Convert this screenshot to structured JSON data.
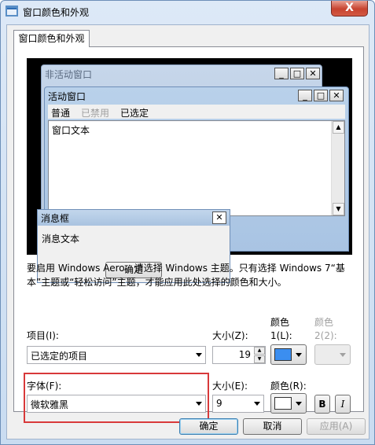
{
  "window": {
    "title": "窗口颜色和外观",
    "close_label": "X"
  },
  "tab": {
    "label": "窗口颜色和外观"
  },
  "preview": {
    "inactive_title": "非活动窗口",
    "active_title": "活动窗口",
    "menu": [
      "普通",
      "已禁用",
      "已选定"
    ],
    "window_text": "窗口文本",
    "msgbox_title": "消息框",
    "msgbox_text": "消息文本",
    "msgbox_ok": "确定"
  },
  "description": "要启用 Windows Aero，请选择 Windows 主题。只有选择 Windows 7“基本”主题或“轻松访问”主题，才能应用此处选择的颜色和大小。",
  "item": {
    "label": "项目(I):",
    "value": "已选定的项目",
    "size_label": "大小(Z):",
    "size_value": "19",
    "color1_label": "颜色\n1(L):",
    "color2_label": "颜色\n2(2):"
  },
  "font": {
    "label": "字体(F):",
    "value": "微软雅黑",
    "size_label": "大小(E):",
    "size_value": "9",
    "color_label": "颜色(R):",
    "bold": "B",
    "italic": "I"
  },
  "buttons": {
    "ok": "确定",
    "cancel": "取消",
    "apply": "应用(A)"
  },
  "colors": {
    "color1": "#3b8ef0",
    "color_font": "#ffffff",
    "highlight": "#d8393a"
  }
}
